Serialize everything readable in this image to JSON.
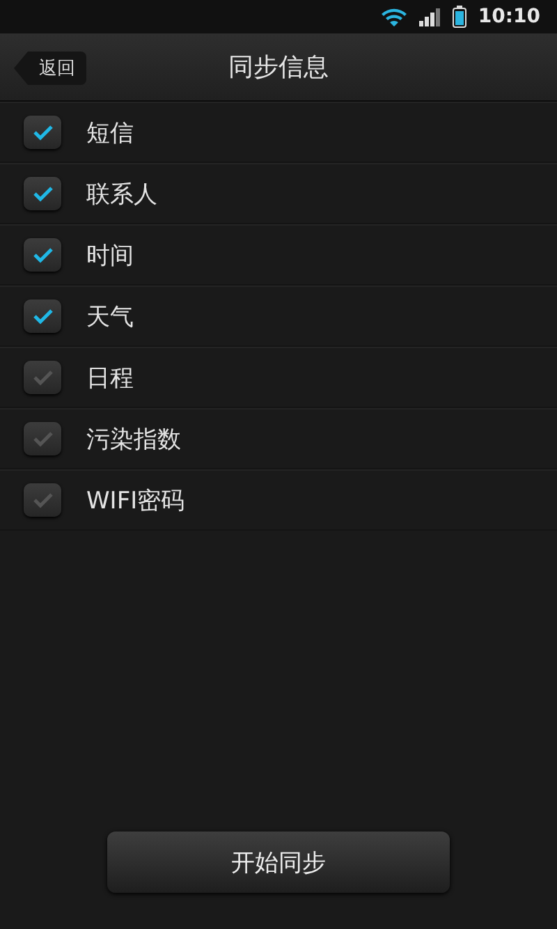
{
  "status_bar": {
    "time": "10:10"
  },
  "header": {
    "back": "返回",
    "title": "同步信息"
  },
  "items": [
    {
      "label": "短信",
      "checked": true
    },
    {
      "label": "联系人",
      "checked": true
    },
    {
      "label": "时间",
      "checked": true
    },
    {
      "label": "天气",
      "checked": true
    },
    {
      "label": "日程",
      "checked": false
    },
    {
      "label": "污染指数",
      "checked": false
    },
    {
      "label": "WIFI密码",
      "checked": false
    }
  ],
  "button": "开始同步"
}
